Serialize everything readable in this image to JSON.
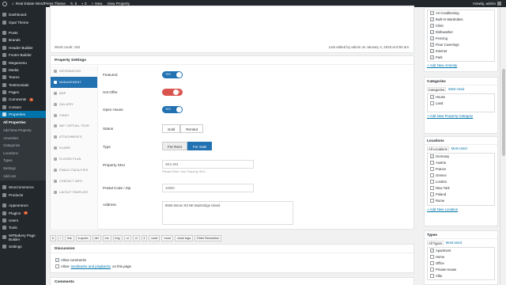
{
  "admin_bar": {
    "site": "Real Estate WordPress Theme",
    "updates": "5",
    "comments": "0",
    "new": "New",
    "view": "View Property",
    "howdy": "Howdy, admin"
  },
  "sidebar": {
    "top": [
      {
        "label": "Dashboard"
      },
      {
        "label": "Opal Theme"
      }
    ],
    "items": [
      {
        "label": "Posts"
      },
      {
        "label": "Brands"
      },
      {
        "label": "Header Builder"
      },
      {
        "label": "Footer Builder"
      },
      {
        "label": "Megamenu"
      },
      {
        "label": "Media"
      },
      {
        "label": "Teams"
      },
      {
        "label": "Testimonials"
      },
      {
        "label": "Pages"
      },
      {
        "label": "Comments",
        "badge": "3"
      },
      {
        "label": "Contact"
      }
    ],
    "active": {
      "label": "Properties"
    },
    "submenu": [
      "All Properties",
      "Add New Property",
      "Amenities",
      "Categories",
      "Locations",
      "Types",
      "Settings",
      "Add-ons"
    ],
    "bottom": [
      {
        "label": "WooCommerce"
      },
      {
        "label": "Products"
      },
      {
        "label": "Appearance"
      },
      {
        "label": "Plugins",
        "badge": "4"
      },
      {
        "label": "Users"
      },
      {
        "label": "Tools"
      },
      {
        "label": "WPBakery Page Builder"
      },
      {
        "label": "Settings"
      }
    ]
  },
  "editor": {
    "word_count": "Word count: 152",
    "last_edited": "Last edited by admin on January 4, 2018 at 8:50 am"
  },
  "settings": {
    "title": "Property Settings",
    "tabs": [
      "Information",
      "Management",
      "Map",
      "Gallery",
      "Video",
      "360° Virtual Tour",
      "Attachments",
      "Slider",
      "Floors Plan",
      "Public Facilities",
      "Contact Info",
      "Layout Template"
    ],
    "featured": {
      "label": "Featured",
      "value": "YES"
    },
    "hot_offer": {
      "label": "Hot Offer",
      "value": "NO"
    },
    "open_house": {
      "label": "Open House",
      "value": "YES"
    },
    "status": {
      "label": "Status",
      "options": [
        "Sold",
        "Rented"
      ]
    },
    "type": {
      "label": "Type",
      "options": [
        "For Rent",
        "For Sale"
      ]
    },
    "sku": {
      "label": "Property SKU",
      "value": "SKU 001",
      "hint": "Please Enter Your Property SKU"
    },
    "zip": {
      "label": "Postal Code / Zip",
      "value": "10000"
    },
    "address": {
      "label": "Address",
      "value": "8555 Moran Rd NE Bainbridge Island"
    }
  },
  "toolbar": [
    "b",
    "i",
    "link",
    "b-quote",
    "del",
    "ins",
    "img",
    "ul",
    "ol",
    "li",
    "code",
    "more",
    "close tags",
    "Elder Resolution"
  ],
  "discussion": {
    "title": "Discussion",
    "allow_comments": "Allow comments",
    "allow_prefix": "Allow ",
    "trackbacks": "trackbacks and pingbacks",
    "allow_suffix": " on this page"
  },
  "comments_title": "Comments",
  "amenities": {
    "items": [
      "Air Conditioning",
      "Built-In Wardrobes",
      "Clinic",
      "Dishwasher",
      "Fencing",
      "Floor Coverings",
      "Internet",
      "Park"
    ],
    "add": "+ Add New Amenity"
  },
  "categories": {
    "title": "Categories",
    "tab_all": "Categories",
    "tab_used": "Most Used",
    "items": [
      "House",
      "Land"
    ],
    "add": "+ Add New Property Category"
  },
  "locations": {
    "title": "Locations",
    "tab_all": "All Locations",
    "tab_used": "Most Used",
    "items": [
      "Germany",
      "Austria",
      "France",
      "Greece",
      "London",
      "New York",
      "Poland",
      "Rome"
    ],
    "add": "+ Add New Location"
  },
  "types": {
    "title": "Types",
    "tab_all": "All Types",
    "tab_used": "Most Used",
    "items": [
      "Apartment",
      "Home",
      "Office",
      "Private House",
      "Villa"
    ]
  },
  "colors": {
    "accent": "#2271b1",
    "sidebar": "#23282d",
    "danger": "#d9534f"
  }
}
